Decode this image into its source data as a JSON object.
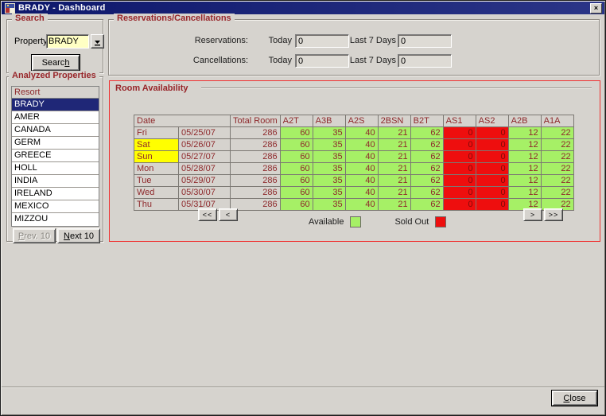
{
  "window": {
    "title": "BRADY - Dashboard",
    "close_glyph": "×"
  },
  "search": {
    "title": "Search",
    "property_label": "Property",
    "property_value": "BRADY",
    "button": {
      "label": "Search",
      "underline": 5
    }
  },
  "analyzed_properties": {
    "title": "Analyzed Properties",
    "list_header": "Resort",
    "selected_item": "BRADY",
    "items": [
      "BRADY",
      "AMER",
      "CANADA",
      "GERM",
      "GREECE",
      "HOLL",
      "INDIA",
      "IRELAND",
      "MEXICO",
      "MIZZOU"
    ],
    "prev_button": {
      "label": "Prev. 10",
      "underline": 0,
      "disabled": true
    },
    "next_button": {
      "label": "Next 10",
      "underline": 0,
      "disabled": false
    }
  },
  "reservations_cancellations": {
    "title": "Reservations/Cancellations",
    "rows": [
      {
        "label": "Reservations:",
        "today_label": "Today",
        "today_value": "0",
        "last7_label": "Last 7 Days",
        "last7_value": "0"
      },
      {
        "label": "Cancellations:",
        "today_label": "Today",
        "today_value": "0",
        "last7_label": "Last 7 Days",
        "last7_value": "0"
      }
    ]
  },
  "room_availability": {
    "title": "Room Availability",
    "columns": [
      "Date",
      "Total Room",
      "A2T",
      "A3B",
      "A2S",
      "2BSN",
      "B2T",
      "AS1",
      "AS2",
      "A2B",
      "A1A"
    ],
    "sold_out_columns": [
      "AS1",
      "AS2"
    ],
    "rows": [
      {
        "day": "Fri",
        "date": "05/25/07",
        "total": "286",
        "values": [
          "60",
          "35",
          "40",
          "21",
          "62",
          "0",
          "0",
          "12",
          "22"
        ],
        "weekend": false
      },
      {
        "day": "Sat",
        "date": "05/26/07",
        "total": "286",
        "values": [
          "60",
          "35",
          "40",
          "21",
          "62",
          "0",
          "0",
          "12",
          "22"
        ],
        "weekend": true
      },
      {
        "day": "Sun",
        "date": "05/27/07",
        "total": "286",
        "values": [
          "60",
          "35",
          "40",
          "21",
          "62",
          "0",
          "0",
          "12",
          "22"
        ],
        "weekend": true
      },
      {
        "day": "Mon",
        "date": "05/28/07",
        "total": "286",
        "values": [
          "60",
          "35",
          "40",
          "21",
          "62",
          "0",
          "0",
          "12",
          "22"
        ],
        "weekend": false
      },
      {
        "day": "Tue",
        "date": "05/29/07",
        "total": "286",
        "values": [
          "60",
          "35",
          "40",
          "21",
          "62",
          "0",
          "0",
          "12",
          "22"
        ],
        "weekend": false
      },
      {
        "day": "Wed",
        "date": "05/30/07",
        "total": "286",
        "values": [
          "60",
          "35",
          "40",
          "21",
          "62",
          "0",
          "0",
          "12",
          "22"
        ],
        "weekend": false
      },
      {
        "day": "Thu",
        "date": "05/31/07",
        "total": "286",
        "values": [
          "60",
          "35",
          "40",
          "21",
          "62",
          "0",
          "0",
          "12",
          "22"
        ],
        "weekend": false
      }
    ],
    "nav": {
      "first": "<<",
      "prev": "<",
      "next": ">",
      "last": ">>"
    },
    "legend": {
      "available_label": "Available",
      "sold_out_label": "Sold Out"
    }
  },
  "footer": {
    "close_button": {
      "label": "Close",
      "underline": 0
    }
  },
  "colors": {
    "bg": "#d6d3ce",
    "maroon": "#8e282b",
    "maroon_title": "#98262a",
    "available": "#a6f066",
    "sold": "#ee0e0e",
    "weekend": "#ffff00",
    "navy_sel": "#1f2777",
    "titlebar1": "#0d176b",
    "titlebar2": "#2b3587",
    "combo_bg": "#ffffc4",
    "field_bg": "#dedbd5",
    "red_border": "#f03030"
  }
}
